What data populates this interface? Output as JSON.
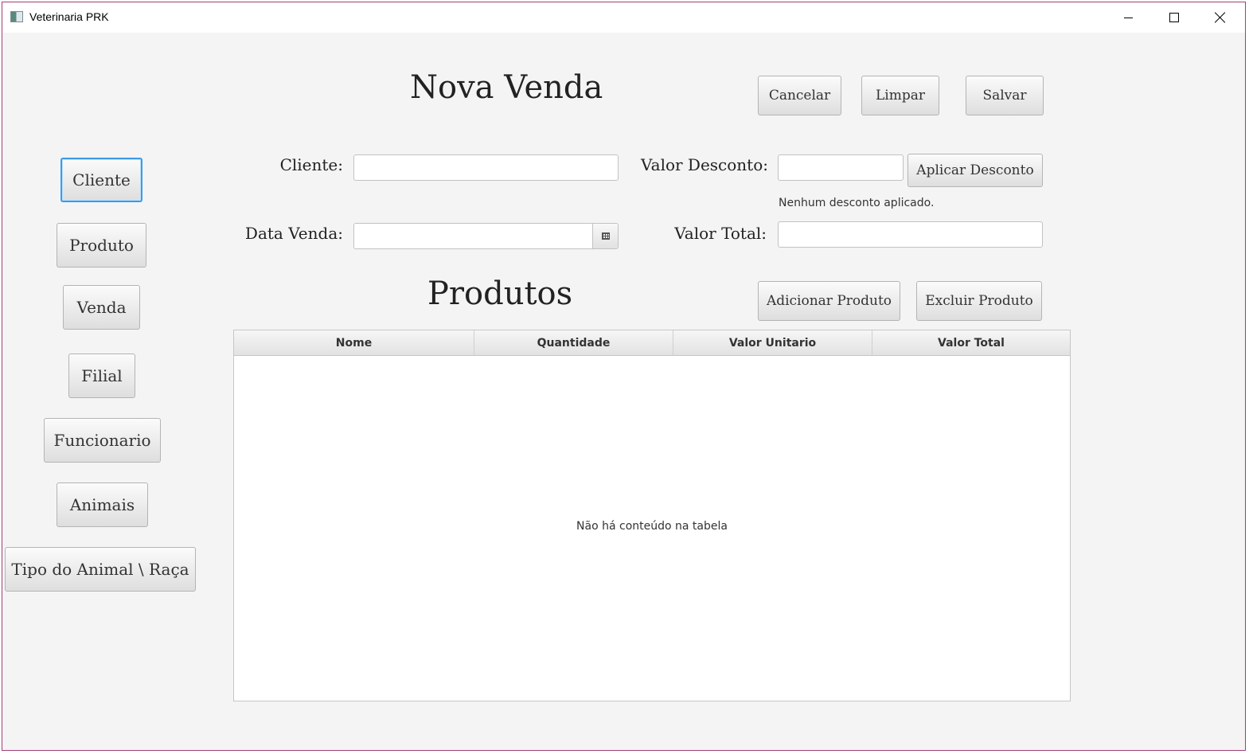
{
  "window": {
    "title": "Veterinaria PRK"
  },
  "sidebar": {
    "items": [
      {
        "label": "Cliente"
      },
      {
        "label": "Produto"
      },
      {
        "label": "Venda"
      },
      {
        "label": "Filial"
      },
      {
        "label": "Funcionario"
      },
      {
        "label": "Animais"
      },
      {
        "label": "Tipo do Animal \\ Raça"
      }
    ]
  },
  "header": {
    "title": "Nova Venda",
    "cancel_label": "Cancelar",
    "clear_label": "Limpar",
    "save_label": "Salvar"
  },
  "form": {
    "cliente_label": "Cliente:",
    "cliente_value": "",
    "data_venda_label": "Data Venda:",
    "data_venda_value": "",
    "valor_desconto_label": "Valor Desconto:",
    "valor_desconto_value": "",
    "aplicar_desconto_label": "Aplicar Desconto",
    "desconto_status": "Nenhum desconto aplicado.",
    "valor_total_label": "Valor Total:",
    "valor_total_value": ""
  },
  "produtos": {
    "title": "Produtos",
    "add_label": "Adicionar Produto",
    "remove_label": "Excluir Produto",
    "columns": [
      "Nome",
      "Quantidade",
      "Valor Unitario",
      "Valor Total"
    ],
    "empty_message": "Não há conteúdo na tabela"
  },
  "colors": {
    "focus_accent": "#3d9be9",
    "window_border": "#a0407a"
  }
}
